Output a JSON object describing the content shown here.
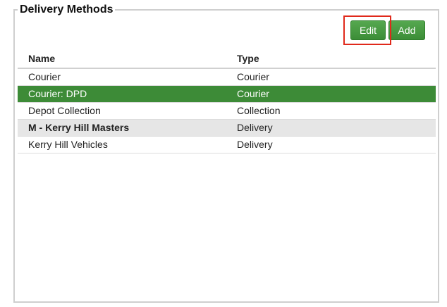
{
  "panel": {
    "title": "Delivery Methods"
  },
  "toolbar": {
    "edit_label": "Edit",
    "add_label": "Add"
  },
  "table": {
    "headers": {
      "name": "Name",
      "type": "Type"
    },
    "rows": [
      {
        "name": "Courier",
        "type": "Courier",
        "state": "normal"
      },
      {
        "name": "Courier: DPD",
        "type": "Courier",
        "state": "selected"
      },
      {
        "name": "Depot Collection",
        "type": "Collection",
        "state": "normal"
      },
      {
        "name": "M - Kerry Hill Masters",
        "type": "Delivery",
        "state": "group"
      },
      {
        "name": "Kerry Hill Vehicles",
        "type": "Delivery",
        "state": "normal"
      }
    ]
  },
  "colors": {
    "accent_green": "#3d8b37",
    "highlight_red": "#e0291b"
  }
}
